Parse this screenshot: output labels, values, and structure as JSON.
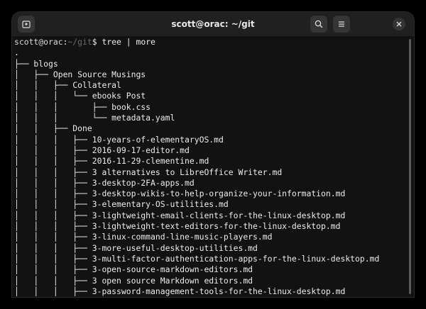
{
  "window": {
    "title": "scott@orac: ~/git"
  },
  "titlebar_icons": {
    "new_tab": "new-tab-icon",
    "search": "search-icon",
    "menu": "hamburger-menu-icon",
    "close": "close-icon"
  },
  "prompt": {
    "user_host": "scott@orac",
    "separator": ":",
    "path": "~/git",
    "symbol": "$",
    "command": " tree | more"
  },
  "output_lines": [
    ".",
    "├── blogs",
    "│   ├── Open Source Musings",
    "│   │   ├── Collateral",
    "│   │   │   └── ebooks Post",
    "│   │   │       ├── book.css",
    "│   │   │       └── metadata.yaml",
    "│   │   ├── Done",
    "│   │   │   ├── 10-years-of-elementaryOS.md",
    "│   │   │   ├── 2016-09-17-editor.md",
    "│   │   │   ├── 2016-11-29-clementine.md",
    "│   │   │   ├── 3 alternatives to LibreOffice Writer.md",
    "│   │   │   ├── 3-desktop-2FA-apps.md",
    "│   │   │   ├── 3-desktop-wikis-to-help-organize-your-information.md",
    "│   │   │   ├── 3-elementary-OS-utilities.md",
    "│   │   │   ├── 3-lightweight-email-clients-for-the-linux-desktop.md",
    "│   │   │   ├── 3-lightweight-text-editors-for-the-linux-desktop.md",
    "│   │   │   ├── 3-linux-command-line-music-players.md",
    "│   │   │   ├── 3-more-useful-desktop-utilities.md",
    "│   │   │   ├── 3-multi-factor-authentication-apps-for-the-linux-desktop.md",
    "│   │   │   ├── 3-open-source-markdown-editors.md",
    "│   │   │   ├── 3 open source Markdown editors.md",
    "│   │   │   ├── 3-password-management-tools-for-the-linux-desktop.md"
  ],
  "colors": {
    "titlebar": "#202020",
    "terminal_bg": "#121212",
    "text": "#ececec",
    "path_dim": "#6a6a6a"
  }
}
